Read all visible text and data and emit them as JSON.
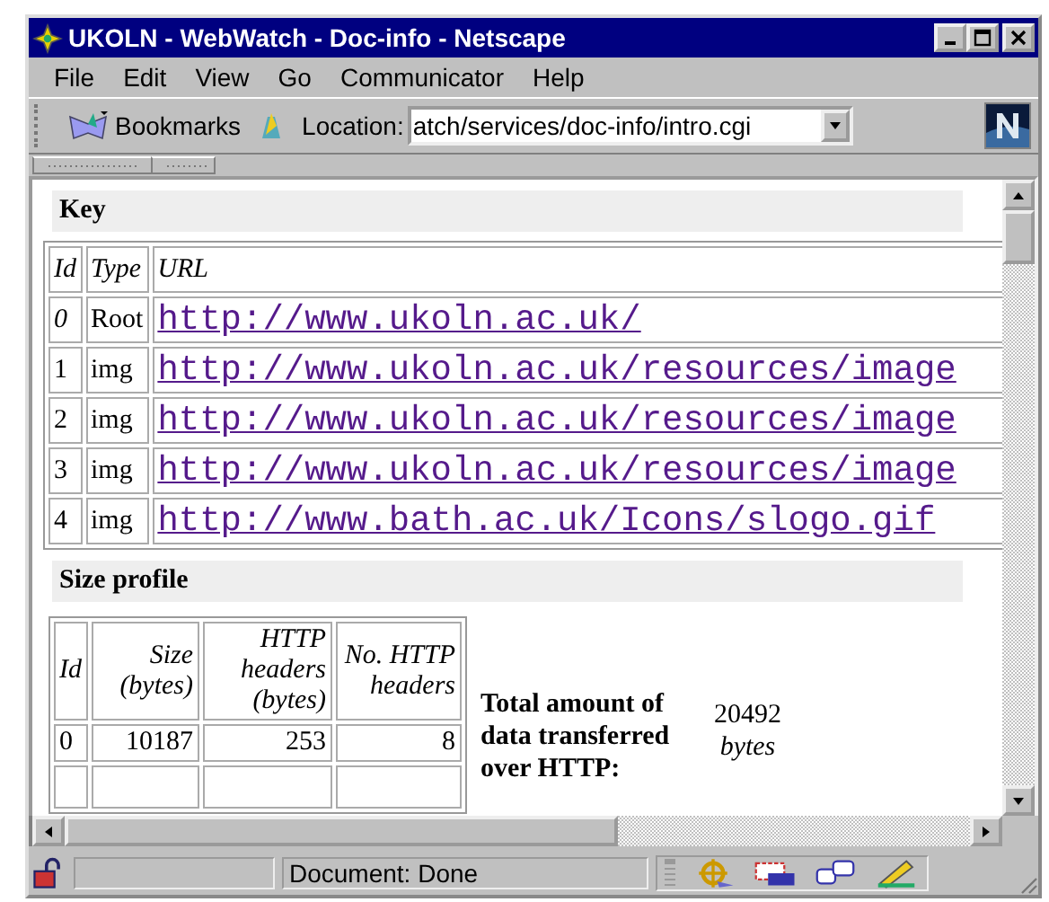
{
  "window": {
    "title": "UKOLN - WebWatch - Doc-info - Netscape"
  },
  "menu": [
    "File",
    "Edit",
    "View",
    "Go",
    "Communicator",
    "Help"
  ],
  "toolbar": {
    "bookmarks": "Bookmarks",
    "location_label": "Location:",
    "location_value": "atch/services/doc-info/intro.cgi"
  },
  "key": {
    "heading": "Key",
    "columns": [
      "Id",
      "Type",
      "URL"
    ],
    "rows": [
      {
        "id": "0",
        "type": "Root",
        "url": "http://www.ukoln.ac.uk/",
        "id_italic": true
      },
      {
        "id": "1",
        "type": "img",
        "url": "http://www.ukoln.ac.uk/resources/image",
        "id_italic": false
      },
      {
        "id": "2",
        "type": "img",
        "url": "http://www.ukoln.ac.uk/resources/image",
        "id_italic": false
      },
      {
        "id": "3",
        "type": "img",
        "url": "http://www.ukoln.ac.uk/resources/image",
        "id_italic": false
      },
      {
        "id": "4",
        "type": "img",
        "url": "http://www.bath.ac.uk/Icons/slogo.gif",
        "id_italic": false
      }
    ]
  },
  "size_profile": {
    "heading": "Size profile",
    "columns": [
      "Id",
      "Size (bytes)",
      "HTTP headers (bytes)",
      "No. HTTP headers"
    ],
    "rows": [
      [
        "0",
        "10187",
        "253",
        "8"
      ]
    ],
    "total_label": "Total amount of data transferred over HTTP:",
    "total_value": "20492",
    "total_unit": "bytes"
  },
  "status_bar": {
    "text": "Document: Done"
  }
}
